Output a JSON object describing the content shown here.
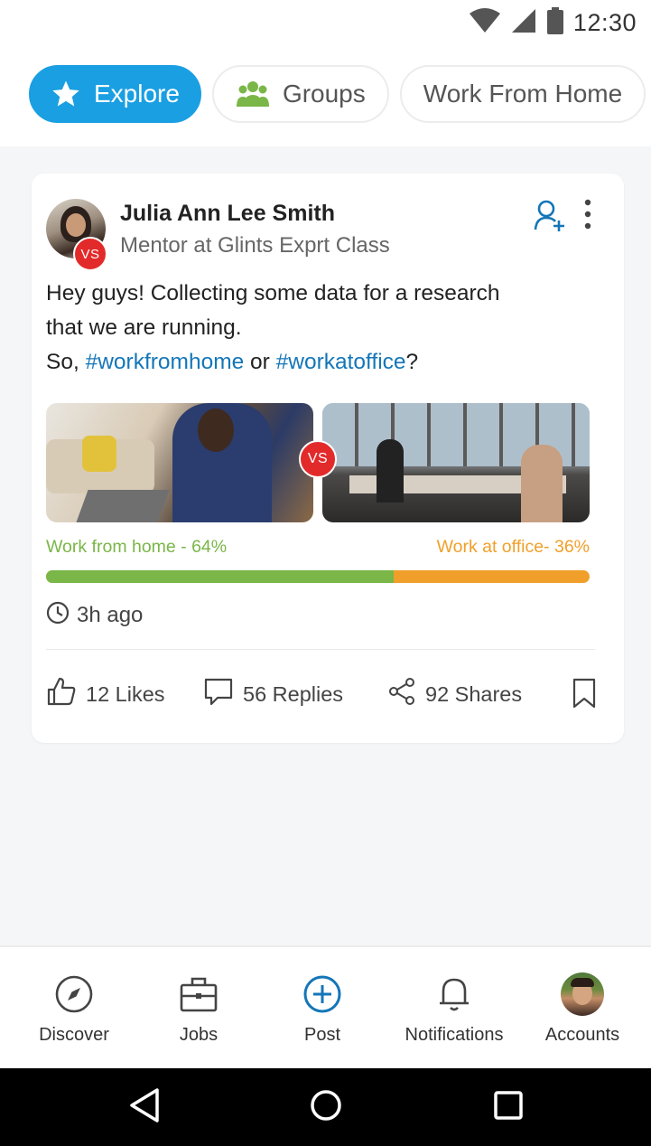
{
  "status_bar": {
    "time": "12:30"
  },
  "chips": [
    {
      "label": "Explore",
      "icon": "star-icon",
      "active": true
    },
    {
      "label": "Groups",
      "icon": "group-icon",
      "active": false
    },
    {
      "label": "Work From Home",
      "active": false
    }
  ],
  "post": {
    "author_name": "Julia Ann Lee Smith",
    "author_role": "Mentor at Glints Exprt Class",
    "badge": "VS",
    "text_line1": "Hey guys! Collecting some data for a research",
    "text_line2": "that we are running.",
    "text_line3_prefix": "So, ",
    "hashtag1": "#workfromhome",
    "text_or": " or ",
    "hashtag2": "#workatoffice",
    "text_suffix": "?",
    "vs_label": "VS",
    "poll": {
      "option_home": "Work from home - 64%",
      "option_office": "Work at office- 36%",
      "home_percent": 64,
      "office_percent": 36,
      "home_color": "#7ab648",
      "office_color": "#f0a02a"
    },
    "time_ago": "3h ago",
    "likes": "12 Likes",
    "replies": "56 Replies",
    "shares": "92 Shares"
  },
  "bottom_nav": [
    {
      "label": "Discover",
      "icon": "compass-icon"
    },
    {
      "label": "Jobs",
      "icon": "briefcase-icon"
    },
    {
      "label": "Post",
      "icon": "plus-circle-icon"
    },
    {
      "label": "Notifications",
      "icon": "bell-icon"
    },
    {
      "label": "Accounts",
      "icon": "avatar"
    }
  ],
  "colors": {
    "accent": "#1a9fe2",
    "hashtag": "#1476b8",
    "badge": "#e32a2a"
  }
}
